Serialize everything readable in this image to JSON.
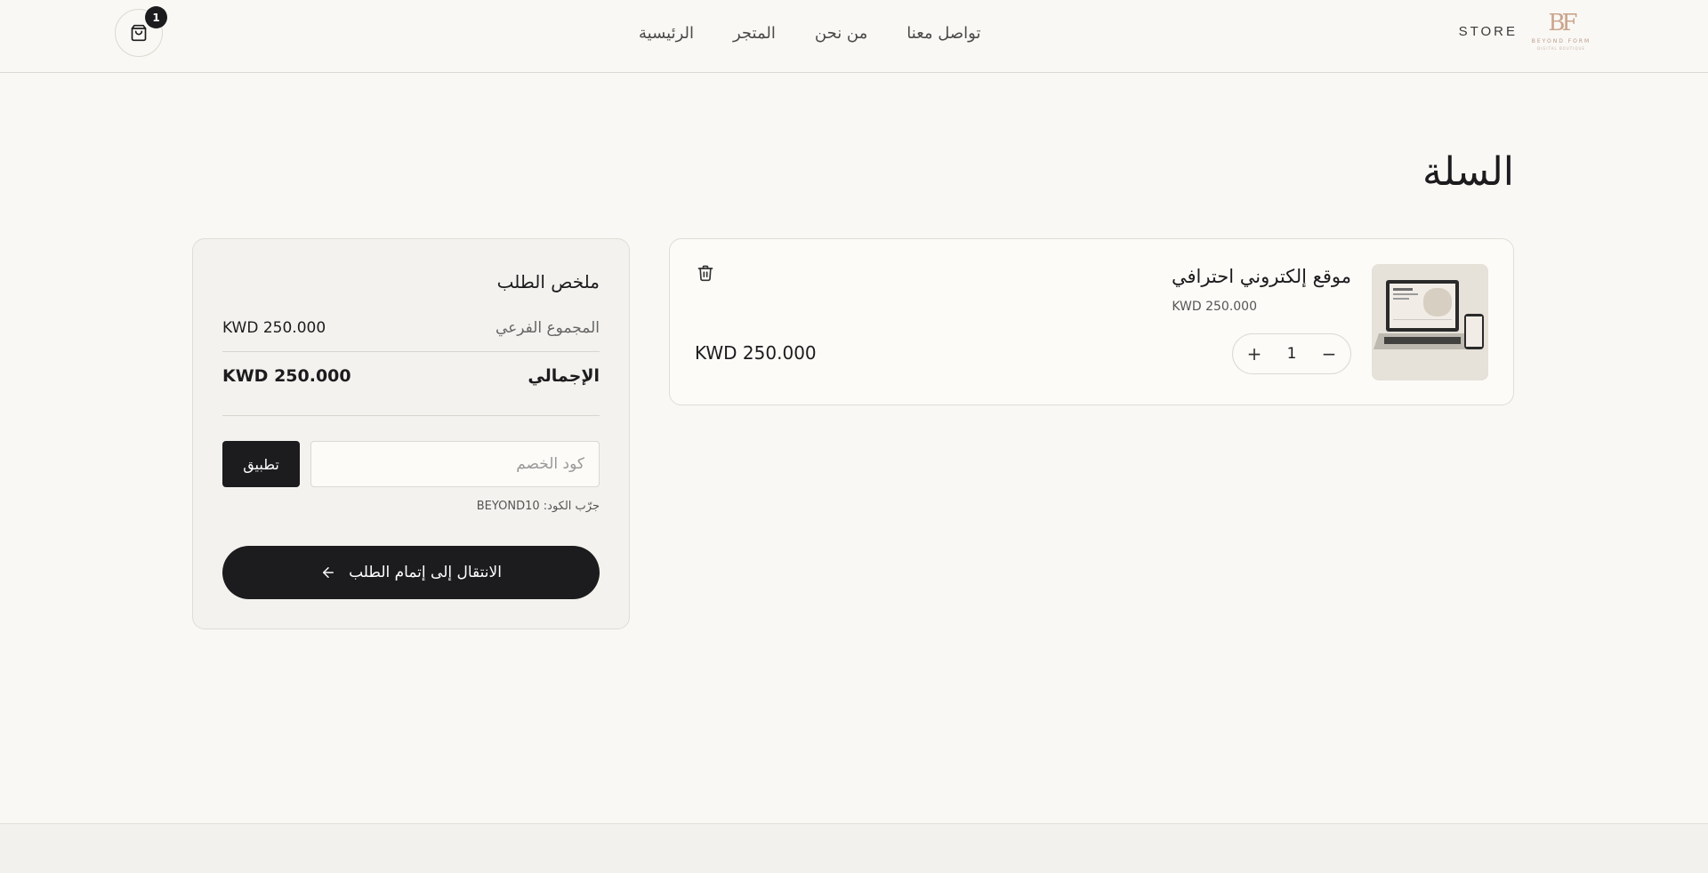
{
  "header": {
    "brand_text": "STORE",
    "logo_mark": "BF",
    "logo_sub": "BEYOND FORM",
    "logo_sub2": "DIGITAL BOUTIQUE",
    "nav": [
      {
        "label": "الرئيسية"
      },
      {
        "label": "المتجر"
      },
      {
        "label": "من نحن"
      },
      {
        "label": "تواصل معنا"
      }
    ],
    "cart_count": "1"
  },
  "page": {
    "title": "السلة"
  },
  "cart_item": {
    "name": "موقع إلكتروني احترافي",
    "unit_price": "KWD 250.000",
    "quantity": "1",
    "decrease_label": "−",
    "increase_label": "+",
    "line_total": "KWD 250.000",
    "thumb_icon": "laptop-image"
  },
  "summary": {
    "title": "ملخص الطلب",
    "subtotal_label": "المجموع الفرعي",
    "subtotal_value": "KWD 250.000",
    "total_label": "الإجمالي",
    "total_value": "KWD 250.000",
    "coupon_placeholder": "كود الخصم",
    "apply_label": "تطبيق",
    "hint": "جرّب الكود: BEYOND10",
    "checkout_label": "الانتقال إلى إتمام الطلب"
  },
  "colors": {
    "background": "#faf8f4",
    "dark": "#1c1c1e",
    "accent": "#c9a58c"
  }
}
